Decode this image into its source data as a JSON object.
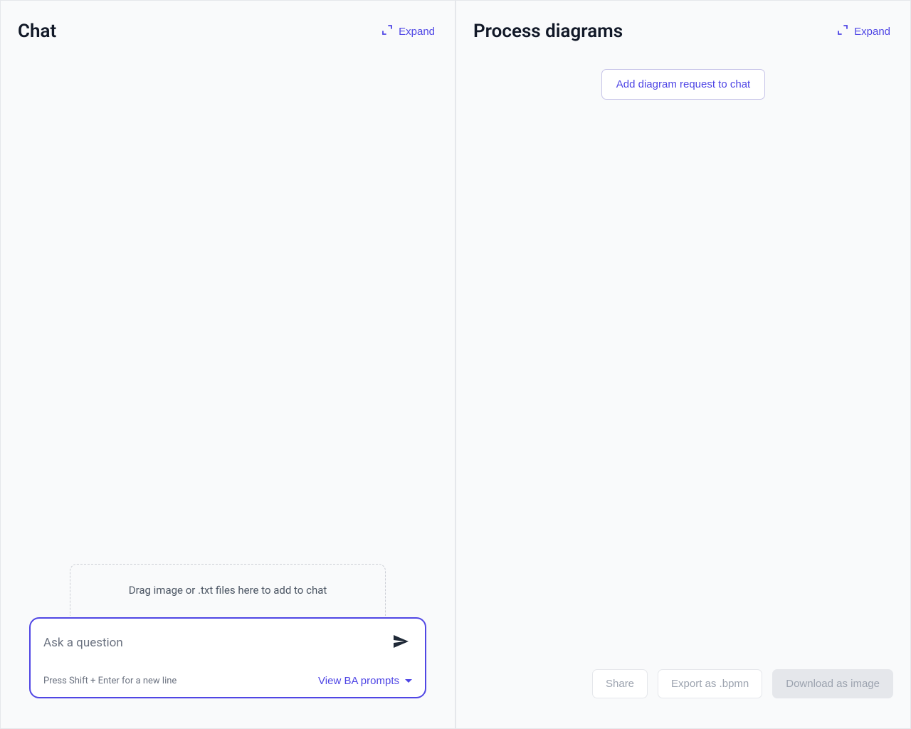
{
  "left": {
    "title": "Chat",
    "expand_label": "Expand",
    "drop_zone_text": "Drag image or .txt files here to add to chat",
    "input_placeholder": "Ask a question",
    "hint": "Press Shift + Enter for a new line",
    "prompts_label": "View BA prompts"
  },
  "right": {
    "title": "Process diagrams",
    "expand_label": "Expand",
    "add_diagram_label": "Add diagram request to chat",
    "share_label": "Share",
    "export_label": "Export as .bpmn",
    "download_label": "Download as image"
  }
}
